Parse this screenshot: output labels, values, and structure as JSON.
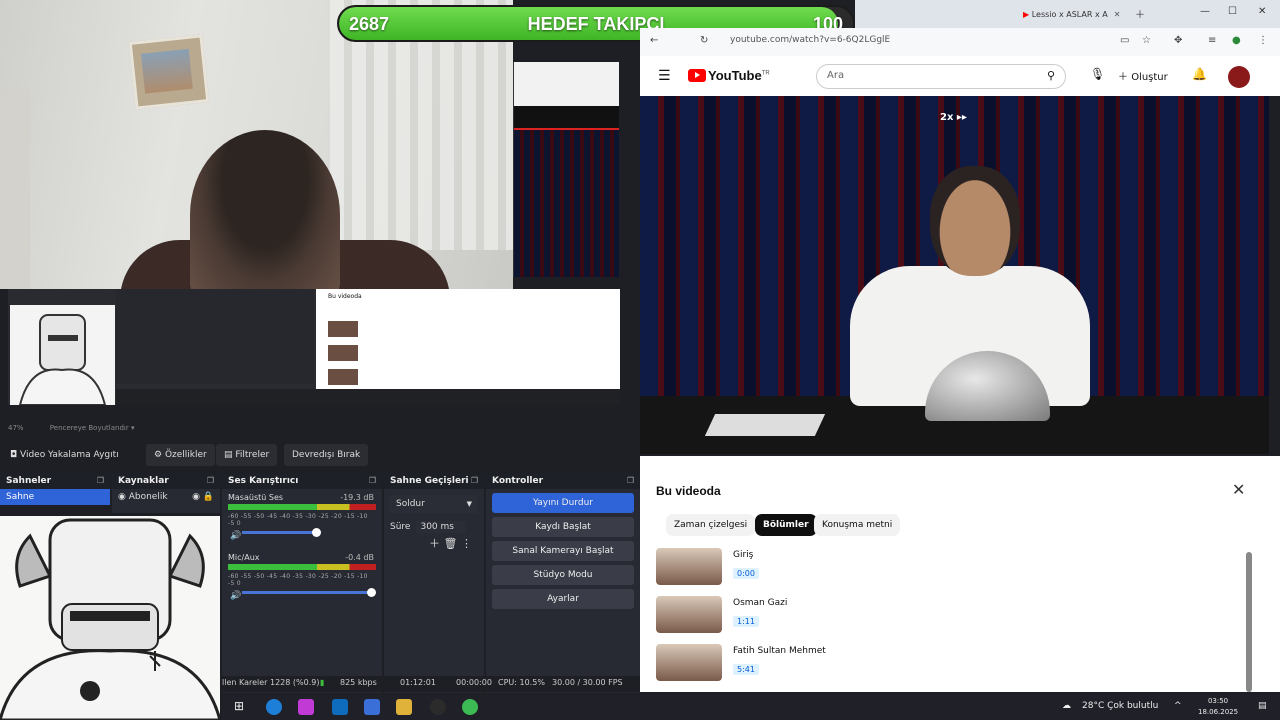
{
  "goal": {
    "current": "2687",
    "title": "HEDEF TAKIPÇI",
    "target": "100"
  },
  "obs": {
    "zoom_label": "47%",
    "fit_label": "Pencereye Boyutlandır",
    "toolbar": {
      "source": "Video Yakalama Aygıtı",
      "properties": "Özellikler",
      "filters": "Filtreler",
      "deactivate": "Devredışı Bırak"
    },
    "docks": {
      "scenes": {
        "title": "Sahneler",
        "items": [
          "Sahne"
        ]
      },
      "sources": {
        "title": "Kaynaklar",
        "items": [
          "Abonelik"
        ]
      },
      "mixer": {
        "title": "Ses Karıştırıcı",
        "channels": [
          {
            "name": "Masaüstü Ses",
            "db": "-19.3 dB"
          },
          {
            "name": "Mic/Aux",
            "db": "-0.4 dB"
          }
        ],
        "scale": "-60 -55 -50 -45 -40 -35 -30 -25 -20 -15 -10 -5 0"
      },
      "transitions": {
        "title": "Sahne Geçişleri",
        "selected": "Soldur",
        "duration_label": "Süre",
        "duration_value": "300 ms"
      },
      "controls": {
        "title": "Kontroller",
        "stop_stream": "Yayını Durdur",
        "start_record": "Kaydı Başlat",
        "start_virtualcam": "Sanal Kamerayı Başlat",
        "studio_mode": "Stüdyo Modu",
        "settings": "Ayarlar"
      }
    },
    "status": {
      "dropped": "llen Kareler 1228 (%0.9)",
      "bitrate": "825 kbps",
      "live_time": "01:12:01",
      "rec_time": "00:00:00",
      "cpu": "CPU: 10.5%",
      "fps": "30.00 / 30.00 FPS"
    }
  },
  "browser": {
    "tabs": [
      {
        "label": "Lessio x ASLAR x A"
      }
    ],
    "url": "youtube.com/watch?v=6-6Q2LGglE"
  },
  "youtube": {
    "logo": "YouTube",
    "region": "TR",
    "search_placeholder": "Ara",
    "create_label": "Oluştur",
    "speed": "2x",
    "panel_title": "Bu videoda",
    "chips": [
      "Zaman çizelgesi",
      "Bölümler",
      "Konuşma metni"
    ],
    "active_chip": "Bölümler",
    "chapters": [
      {
        "title": "Giriş",
        "time": "0:00"
      },
      {
        "title": "Osman Gazi",
        "time": "1:11"
      },
      {
        "title": "Fatih Sultan Mehmet",
        "time": "5:41"
      }
    ]
  },
  "taskbar": {
    "weather": "28°C  Çok bulutlu",
    "time": "03:50",
    "date": "18.06.2025"
  },
  "colors": {
    "goal_fill": "#3fb526",
    "accent": "#2f63d8",
    "yt_red": "#ff0000"
  }
}
